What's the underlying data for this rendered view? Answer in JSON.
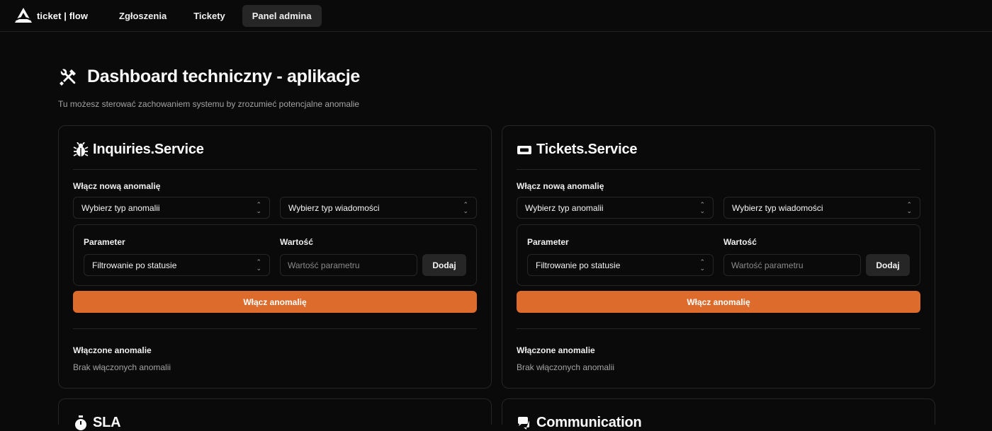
{
  "brand": {
    "name": "ticket | flow"
  },
  "nav": [
    {
      "label": "Zgłoszenia",
      "active": false
    },
    {
      "label": "Tickety",
      "active": false
    },
    {
      "label": "Panel admina",
      "active": true
    }
  ],
  "page": {
    "title": "Dashboard techniczny - aplikacje",
    "subtitle": "Tu możesz sterować zachowaniem systemu by zrozumieć potencjalne anomalie"
  },
  "colors": {
    "accent": "#dd6b2c",
    "background": "#0a0a0a",
    "border": "#262626"
  },
  "cards": [
    {
      "title": "Inquiries.Service",
      "icon": "bug-icon",
      "new_anomaly_label": "Włącz nową anomalię",
      "anomaly_type_select": "Wybierz typ anomalii",
      "message_type_select": "Wybierz typ wiadomości",
      "parameter_label": "Parameter",
      "value_label": "Wartość",
      "parameter_select": "Filtrowanie po statusie",
      "value_placeholder": "Wartość parametru",
      "add_button": "Dodaj",
      "enable_button": "Włącz anomalię",
      "enabled_label": "Włączone anomalie",
      "empty_text": "Brak włączonych anomalii"
    },
    {
      "title": "Tickets.Service",
      "icon": "ticket-icon",
      "new_anomaly_label": "Włącz nową anomalię",
      "anomaly_type_select": "Wybierz typ anomalii",
      "message_type_select": "Wybierz typ wiadomości",
      "parameter_label": "Parameter",
      "value_label": "Wartość",
      "parameter_select": "Filtrowanie po statusie",
      "value_placeholder": "Wartość parametru",
      "add_button": "Dodaj",
      "enable_button": "Włącz anomalię",
      "enabled_label": "Włączone anomalie",
      "empty_text": "Brak włączonych anomalii"
    },
    {
      "title": "SLA",
      "icon": "timer-icon"
    },
    {
      "title": "Communication",
      "icon": "chat-icon"
    }
  ]
}
